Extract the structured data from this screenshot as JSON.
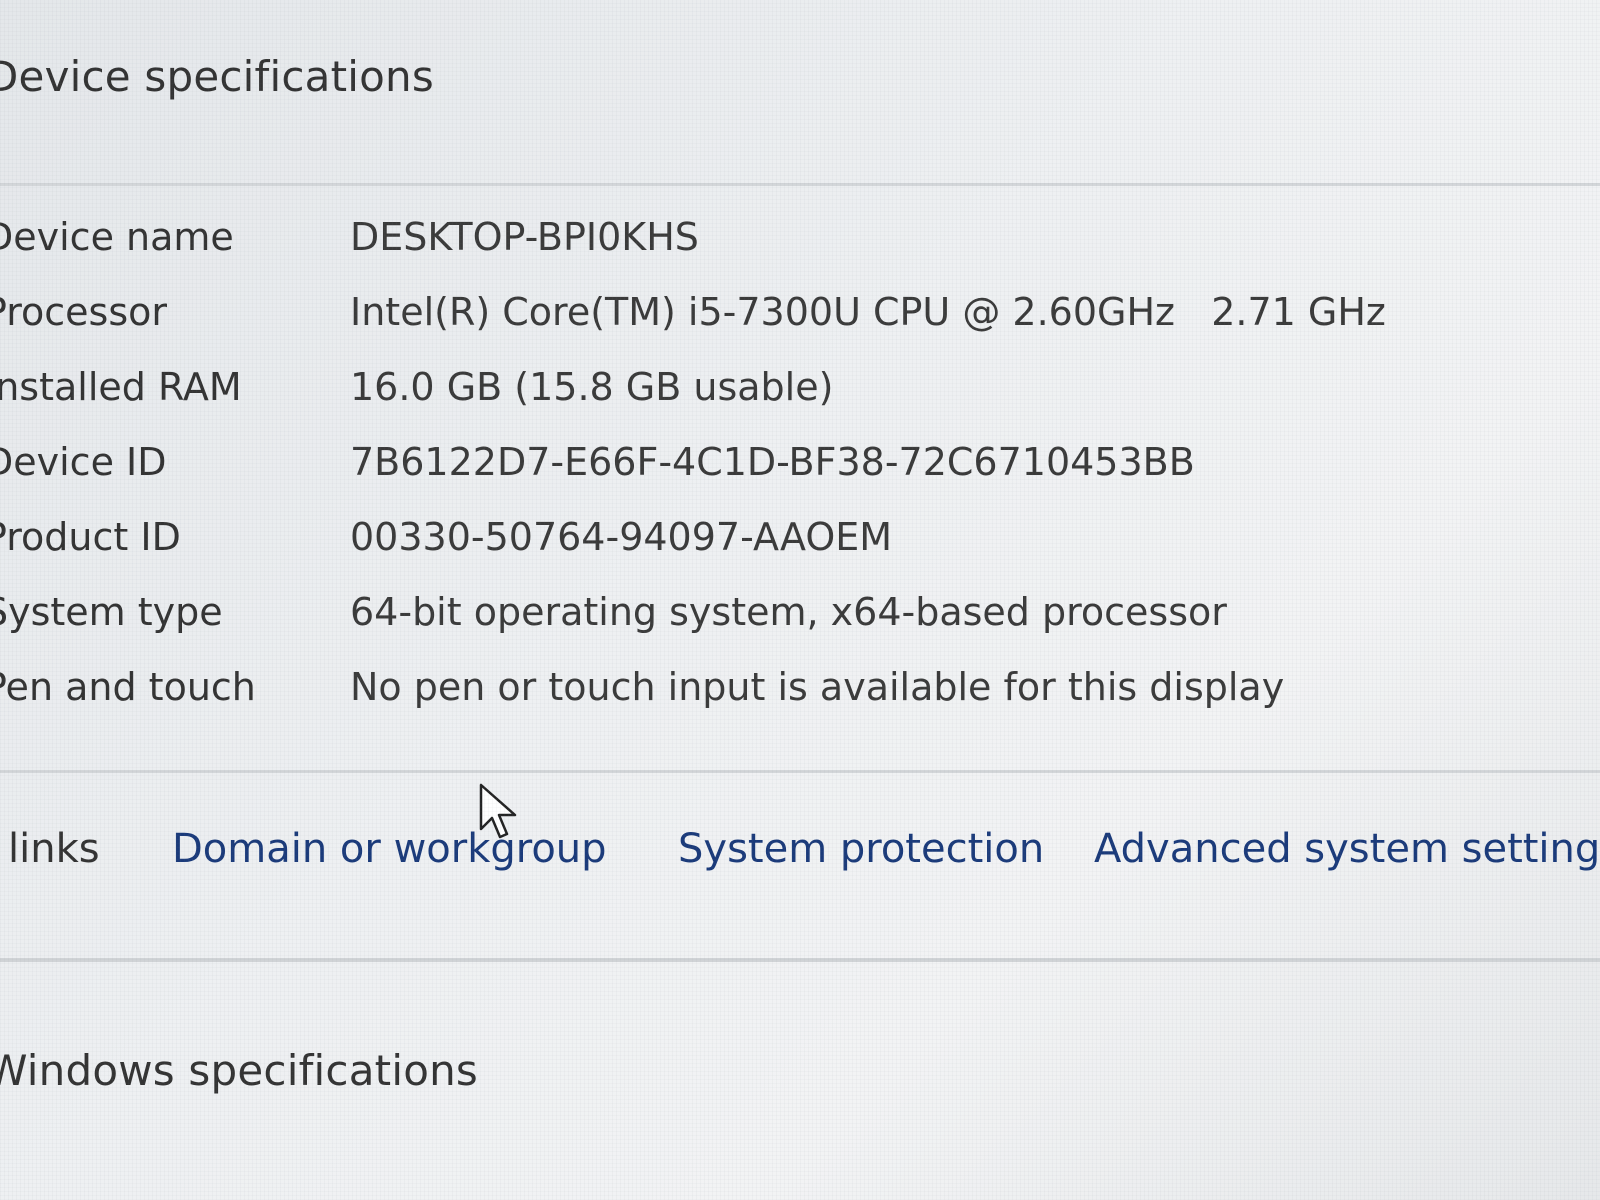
{
  "device_specifications": {
    "title": "Device specifications",
    "rows": [
      {
        "label": "Device name",
        "value": "DESKTOP-BPI0KHS"
      },
      {
        "label": "Processor",
        "value": "Intel(R) Core(TM) i5-7300U CPU @ 2.60GHz   2.71 GHz"
      },
      {
        "label": "Installed RAM",
        "value": "16.0 GB (15.8 GB usable)"
      },
      {
        "label": "Device ID",
        "value": "7B6122D7-E66F-4C1D-BF38-72C6710453BB"
      },
      {
        "label": "Product ID",
        "value": "00330-50764-94097-AAOEM"
      },
      {
        "label": "System type",
        "value": "64-bit operating system, x64-based processor"
      },
      {
        "label": "Pen and touch",
        "value": "No pen or touch input is available for this display"
      }
    ]
  },
  "related_links": {
    "label": "links",
    "items": [
      {
        "label": "Domain or workgroup"
      },
      {
        "label": "System protection"
      },
      {
        "label": "Advanced system settings"
      }
    ]
  },
  "windows_specifications": {
    "title": "Windows specifications"
  },
  "icons": {
    "cursor": "mouse-pointer-icon"
  }
}
